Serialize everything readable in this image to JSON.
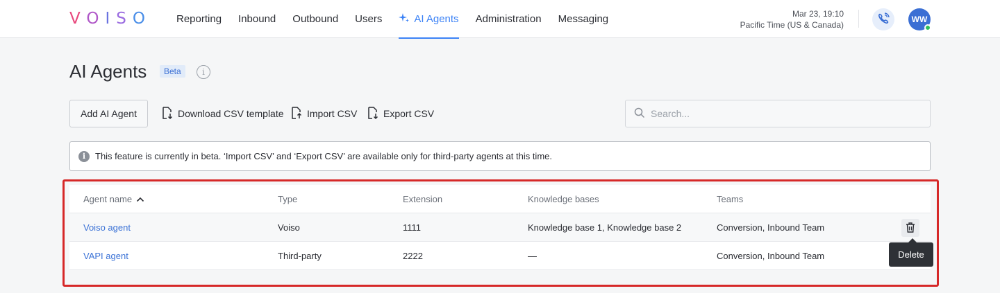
{
  "logo": {
    "letters": [
      "V",
      "O",
      "I",
      "S",
      "O"
    ]
  },
  "nav": {
    "items": [
      {
        "label": "Reporting"
      },
      {
        "label": "Inbound"
      },
      {
        "label": "Outbound"
      },
      {
        "label": "Users"
      },
      {
        "label": "AI Agents",
        "active": true,
        "icon": "sparkle-icon"
      },
      {
        "label": "Administration"
      },
      {
        "label": "Messaging"
      }
    ]
  },
  "clock": {
    "datetime": "Mar 23, 19:10",
    "timezone": "Pacific Time (US & Canada)"
  },
  "user": {
    "initials": "WW",
    "status_color": "#2ebf5a"
  },
  "page": {
    "title": "AI Agents",
    "badge": "Beta"
  },
  "toolbar": {
    "add_label": "Add AI Agent",
    "download_label": "Download CSV template",
    "import_label": "Import CSV",
    "export_label": "Export CSV",
    "search_placeholder": "Search..."
  },
  "banner": {
    "text": "This feature is currently in beta. ‘Import CSV’ and ‘Export CSV’ are available only for third-party agents at this time."
  },
  "table": {
    "columns": [
      "Agent name",
      "Type",
      "Extension",
      "Knowledge bases",
      "Teams"
    ],
    "sort": {
      "column": "Agent name",
      "direction": "asc"
    },
    "rows": [
      {
        "name": "Voiso agent",
        "type": "Voiso",
        "extension": "1111",
        "knowledge_bases": "Knowledge base 1, Knowledge base 2",
        "teams": "Conversion, Inbound Team"
      },
      {
        "name": "VAPI agent",
        "type": "Third-party",
        "extension": "2222",
        "knowledge_bases": "—",
        "teams": "Conversion, Inbound Team"
      }
    ]
  },
  "tooltip": {
    "text": "Delete"
  },
  "colors": {
    "accent": "#3b82f6",
    "link": "#3b72d6",
    "highlight_border": "#d62828"
  }
}
